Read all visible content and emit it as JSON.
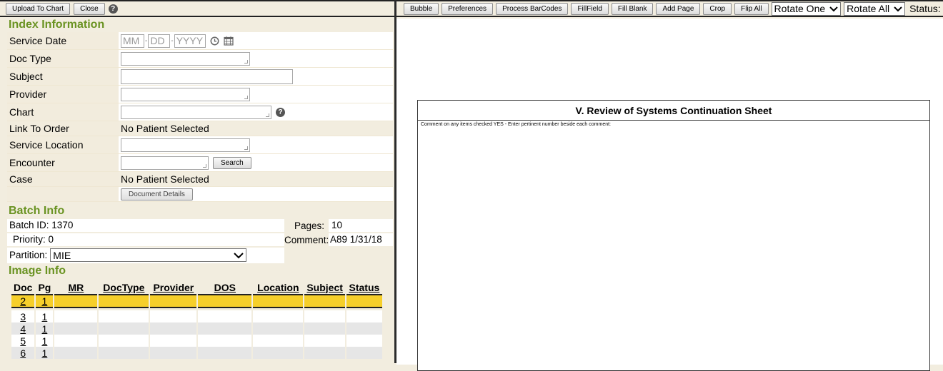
{
  "toolbar_left": {
    "upload_label": "Upload To Chart",
    "close_label": "Close",
    "help_glyph": "?"
  },
  "toolbar_right": {
    "buttons": [
      "Bubble",
      "Preferences",
      "Process BarCodes",
      "FillField",
      "Fill Blank",
      "Add Page",
      "Crop",
      "Flip All"
    ],
    "rotate_one": "Rotate One",
    "rotate_all": "Rotate All",
    "status_label": "Status: Rea"
  },
  "index": {
    "title": "Index Information",
    "fields": {
      "service_date": "Service Date",
      "doc_type": "Doc Type",
      "subject": "Subject",
      "provider": "Provider",
      "chart": "Chart",
      "link_to_order": "Link To Order",
      "service_location": "Service Location",
      "encounter": "Encounter",
      "case": "Case"
    },
    "date_placeholders": {
      "mm": "MM",
      "dd": "DD",
      "yyyy": "YYYY"
    },
    "link_to_order_value": "No Patient Selected",
    "case_value": "No Patient Selected",
    "search_label": "Search",
    "document_details_label": "Document Details"
  },
  "batch": {
    "title": "Batch Info",
    "batch_id_label": "Batch ID:",
    "batch_id": "1370",
    "pages_label": "Pages:",
    "pages": "10",
    "priority_label": "Priority:",
    "priority": "0",
    "comment_label": "Comment:",
    "comment": "A89 1/31/18",
    "partition_label": "Partition:",
    "partition": "MIE"
  },
  "image": {
    "title": "Image Info",
    "headers": [
      "Doc",
      "Pg",
      "MR",
      "DocType",
      "Provider",
      "DOS",
      "Location",
      "Subject",
      "Status"
    ],
    "rows": [
      {
        "doc": "2",
        "pg": "1"
      },
      {
        "doc": "3",
        "pg": "1"
      },
      {
        "doc": "4",
        "pg": "1"
      },
      {
        "doc": "5",
        "pg": "1"
      },
      {
        "doc": "6",
        "pg": "1"
      }
    ]
  },
  "document": {
    "sheet_title": "V. Review of Systems Continuation Sheet",
    "instruction": "Comment on any items checked YES - Enter pertinent number beside each comment:"
  },
  "icons": {
    "help": "help-icon",
    "clock": "clock-icon",
    "calendar": "calendar-icon",
    "dropdown": "chevron-down-icon"
  },
  "colors": {
    "section_title": "#6a9322",
    "selected_row": "#f6cf2a",
    "panel_bg": "#f2eddf"
  }
}
